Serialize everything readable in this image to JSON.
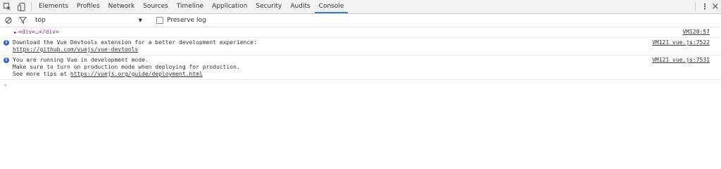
{
  "toolbar": {
    "tabs": [
      "Elements",
      "Profiles",
      "Network",
      "Sources",
      "Timeline",
      "Application",
      "Security",
      "Audits",
      "Console"
    ],
    "active_tab": "Console"
  },
  "filter": {
    "context": "top",
    "preserve_log_label": "Preserve log"
  },
  "console": {
    "messages": [
      {
        "type": "log",
        "text": "<div>…</div>",
        "source": "VM120:57"
      },
      {
        "type": "info",
        "line1": "Download the Vue Devtools extension for a better development experience:",
        "link": "https://github.com/vuejs/vue-devtools",
        "source": "VM121 vue.js:7522"
      },
      {
        "type": "info",
        "line1": "You are running Vue in development mode.",
        "line2": "Make sure to turn on production mode when deploying for production.",
        "line3_prefix": "See more tips at ",
        "link": "https://vuejs.org/guide/deployment.html",
        "source": "VM121 vue.js:7531"
      }
    ],
    "prompt": "›"
  },
  "colors": {
    "accent": "#3879d9",
    "info_icon": "#2d6bd6",
    "element_tag": "#8b2a93"
  }
}
